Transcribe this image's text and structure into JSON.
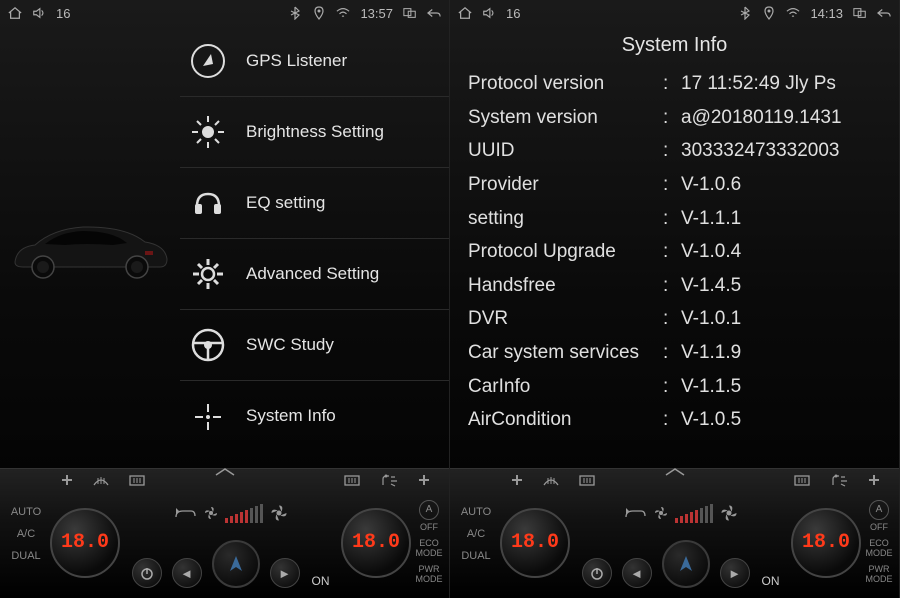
{
  "left": {
    "status": {
      "volume": "16",
      "time": "13:57"
    },
    "menu": [
      {
        "icon": "compass-icon",
        "label": "GPS Listener"
      },
      {
        "icon": "brightness-icon",
        "label": "Brightness Setting"
      },
      {
        "icon": "eq-icon",
        "label": "EQ setting"
      },
      {
        "icon": "gear-icon",
        "label": "Advanced Setting"
      },
      {
        "icon": "steering-icon",
        "label": "SWC Study"
      },
      {
        "icon": "target-icon",
        "label": "System Info"
      }
    ]
  },
  "right": {
    "status": {
      "volume": "16",
      "time": "14:13"
    },
    "title": "System Info",
    "rows": [
      {
        "k": "Protocol version",
        "v": "17 11:52:49 Jly Ps"
      },
      {
        "k": "System version",
        "v": "a@20180119.1431"
      },
      {
        "k": "UUID",
        "v": "303332473332003"
      },
      {
        "k": "Provider",
        "v": "V-1.0.6"
      },
      {
        "k": "setting",
        "v": "V-1.1.1"
      },
      {
        "k": "Protocol Upgrade",
        "v": "V-1.0.4"
      },
      {
        "k": "Handsfree",
        "v": "V-1.4.5"
      },
      {
        "k": "DVR",
        "v": "V-1.0.1"
      },
      {
        "k": "Car system services",
        "v": "V-1.1.9"
      },
      {
        "k": "CarInfo",
        "v": "V-1.1.5"
      },
      {
        "k": "AirCondition",
        "v": "V-1.0.5"
      }
    ]
  },
  "climate": {
    "auto": "AUTO",
    "ac": "A/C",
    "dual": "DUAL",
    "temp_left": "18.0",
    "temp_right": "18.0",
    "on": "ON",
    "off": "OFF",
    "eco": "ECO",
    "mode": "MODE",
    "pwr": "PWR"
  }
}
